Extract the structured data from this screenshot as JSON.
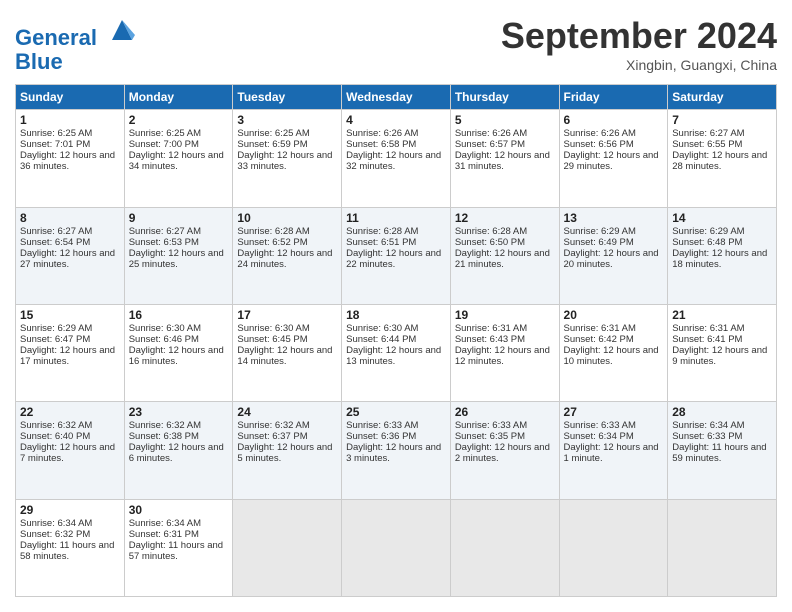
{
  "header": {
    "logo_line1": "General",
    "logo_line2": "Blue",
    "month_title": "September 2024",
    "location": "Xingbin, Guangxi, China"
  },
  "calendar": {
    "days_of_week": [
      "Sunday",
      "Monday",
      "Tuesday",
      "Wednesday",
      "Thursday",
      "Friday",
      "Saturday"
    ],
    "weeks": [
      [
        null,
        {
          "day": "2",
          "sunrise": "6:25 AM",
          "sunset": "7:00 PM",
          "daylight": "12 hours and 34 minutes."
        },
        {
          "day": "3",
          "sunrise": "6:25 AM",
          "sunset": "6:59 PM",
          "daylight": "12 hours and 33 minutes."
        },
        {
          "day": "4",
          "sunrise": "6:26 AM",
          "sunset": "6:58 PM",
          "daylight": "12 hours and 32 minutes."
        },
        {
          "day": "5",
          "sunrise": "6:26 AM",
          "sunset": "6:57 PM",
          "daylight": "12 hours and 31 minutes."
        },
        {
          "day": "6",
          "sunrise": "6:26 AM",
          "sunset": "6:56 PM",
          "daylight": "12 hours and 29 minutes."
        },
        {
          "day": "7",
          "sunrise": "6:27 AM",
          "sunset": "6:55 PM",
          "daylight": "12 hours and 28 minutes."
        }
      ],
      [
        {
          "day": "1",
          "sunrise": "6:25 AM",
          "sunset": "7:01 PM",
          "daylight": "12 hours and 36 minutes."
        },
        {
          "day": "9",
          "sunrise": "6:27 AM",
          "sunset": "6:53 PM",
          "daylight": "12 hours and 25 minutes."
        },
        {
          "day": "10",
          "sunrise": "6:28 AM",
          "sunset": "6:52 PM",
          "daylight": "12 hours and 24 minutes."
        },
        {
          "day": "11",
          "sunrise": "6:28 AM",
          "sunset": "6:51 PM",
          "daylight": "12 hours and 22 minutes."
        },
        {
          "day": "12",
          "sunrise": "6:28 AM",
          "sunset": "6:50 PM",
          "daylight": "12 hours and 21 minutes."
        },
        {
          "day": "13",
          "sunrise": "6:29 AM",
          "sunset": "6:49 PM",
          "daylight": "12 hours and 20 minutes."
        },
        {
          "day": "14",
          "sunrise": "6:29 AM",
          "sunset": "6:48 PM",
          "daylight": "12 hours and 18 minutes."
        }
      ],
      [
        {
          "day": "8",
          "sunrise": "6:27 AM",
          "sunset": "6:54 PM",
          "daylight": "12 hours and 27 minutes."
        },
        {
          "day": "16",
          "sunrise": "6:30 AM",
          "sunset": "6:46 PM",
          "daylight": "12 hours and 16 minutes."
        },
        {
          "day": "17",
          "sunrise": "6:30 AM",
          "sunset": "6:45 PM",
          "daylight": "12 hours and 14 minutes."
        },
        {
          "day": "18",
          "sunrise": "6:30 AM",
          "sunset": "6:44 PM",
          "daylight": "12 hours and 13 minutes."
        },
        {
          "day": "19",
          "sunrise": "6:31 AM",
          "sunset": "6:43 PM",
          "daylight": "12 hours and 12 minutes."
        },
        {
          "day": "20",
          "sunrise": "6:31 AM",
          "sunset": "6:42 PM",
          "daylight": "12 hours and 10 minutes."
        },
        {
          "day": "21",
          "sunrise": "6:31 AM",
          "sunset": "6:41 PM",
          "daylight": "12 hours and 9 minutes."
        }
      ],
      [
        {
          "day": "15",
          "sunrise": "6:29 AM",
          "sunset": "6:47 PM",
          "daylight": "12 hours and 17 minutes."
        },
        {
          "day": "23",
          "sunrise": "6:32 AM",
          "sunset": "6:38 PM",
          "daylight": "12 hours and 6 minutes."
        },
        {
          "day": "24",
          "sunrise": "6:32 AM",
          "sunset": "6:37 PM",
          "daylight": "12 hours and 5 minutes."
        },
        {
          "day": "25",
          "sunrise": "6:33 AM",
          "sunset": "6:36 PM",
          "daylight": "12 hours and 3 minutes."
        },
        {
          "day": "26",
          "sunrise": "6:33 AM",
          "sunset": "6:35 PM",
          "daylight": "12 hours and 2 minutes."
        },
        {
          "day": "27",
          "sunrise": "6:33 AM",
          "sunset": "6:34 PM",
          "daylight": "12 hours and 1 minute."
        },
        {
          "day": "28",
          "sunrise": "6:34 AM",
          "sunset": "6:33 PM",
          "daylight": "11 hours and 59 minutes."
        }
      ],
      [
        {
          "day": "22",
          "sunrise": "6:32 AM",
          "sunset": "6:40 PM",
          "daylight": "12 hours and 7 minutes."
        },
        {
          "day": "30",
          "sunrise": "6:34 AM",
          "sunset": "6:31 PM",
          "daylight": "11 hours and 57 minutes."
        },
        null,
        null,
        null,
        null,
        null
      ],
      [
        {
          "day": "29",
          "sunrise": "6:34 AM",
          "sunset": "6:32 PM",
          "daylight": "11 hours and 58 minutes."
        },
        null,
        null,
        null,
        null,
        null,
        null
      ]
    ]
  }
}
